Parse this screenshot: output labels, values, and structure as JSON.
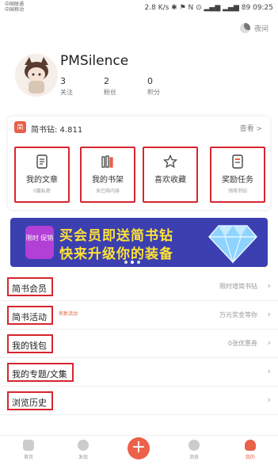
{
  "status_bar": {
    "carrier1": "中国联通",
    "carrier2": "中国移动",
    "right": "2.8 K/s  ✱ ⚑ N ⊙ ▂▄▆ ▂▄▆ 89  09:25"
  },
  "topbar": {
    "night_label": "夜间"
  },
  "profile": {
    "username": "PMSilence",
    "stats": [
      {
        "value": "3",
        "label": "关注"
      },
      {
        "value": "2",
        "label": "粉丝"
      },
      {
        "value": "0",
        "label": "积分"
      }
    ]
  },
  "diamond": {
    "icon": "简",
    "label": "简书钻: 4.811",
    "more": "查看 >"
  },
  "tiles": [
    {
      "label": "我的文章",
      "sub": "0篇私密",
      "icon": "document-icon"
    },
    {
      "label": "我的书架",
      "sub": "含已购内容",
      "icon": "bookshelf-icon"
    },
    {
      "label": "喜欢收藏",
      "sub": "",
      "icon": "star-icon"
    },
    {
      "label": "奖励任务",
      "sub": "领简书钻",
      "icon": "task-icon"
    }
  ],
  "banner": {
    "badge": "限时 促销",
    "line1": "买会员即送简书钻",
    "line2": "快来升级你的装备"
  },
  "menu": [
    {
      "label": "简书会员",
      "hint": "限时增简书钻",
      "tag": ""
    },
    {
      "label": "简书活动",
      "hint": "万元奖金等你",
      "tag": "有新活动"
    },
    {
      "label": "我的钱包",
      "hint": "0张优惠券",
      "tag": ""
    },
    {
      "label": "我的专题/文集",
      "hint": "",
      "tag": ""
    },
    {
      "label": "浏览历史",
      "hint": "",
      "tag": ""
    }
  ],
  "tabbar": {
    "tabs": [
      {
        "label": "首页"
      },
      {
        "label": "发现"
      },
      {
        "label": "消息"
      },
      {
        "label": "我的"
      }
    ],
    "plus": "+"
  },
  "colors": {
    "accent": "#ec6149",
    "highlight_box": "#d6262f",
    "banner_bg": "#3b3fb0",
    "banner_text": "#ffe233"
  }
}
